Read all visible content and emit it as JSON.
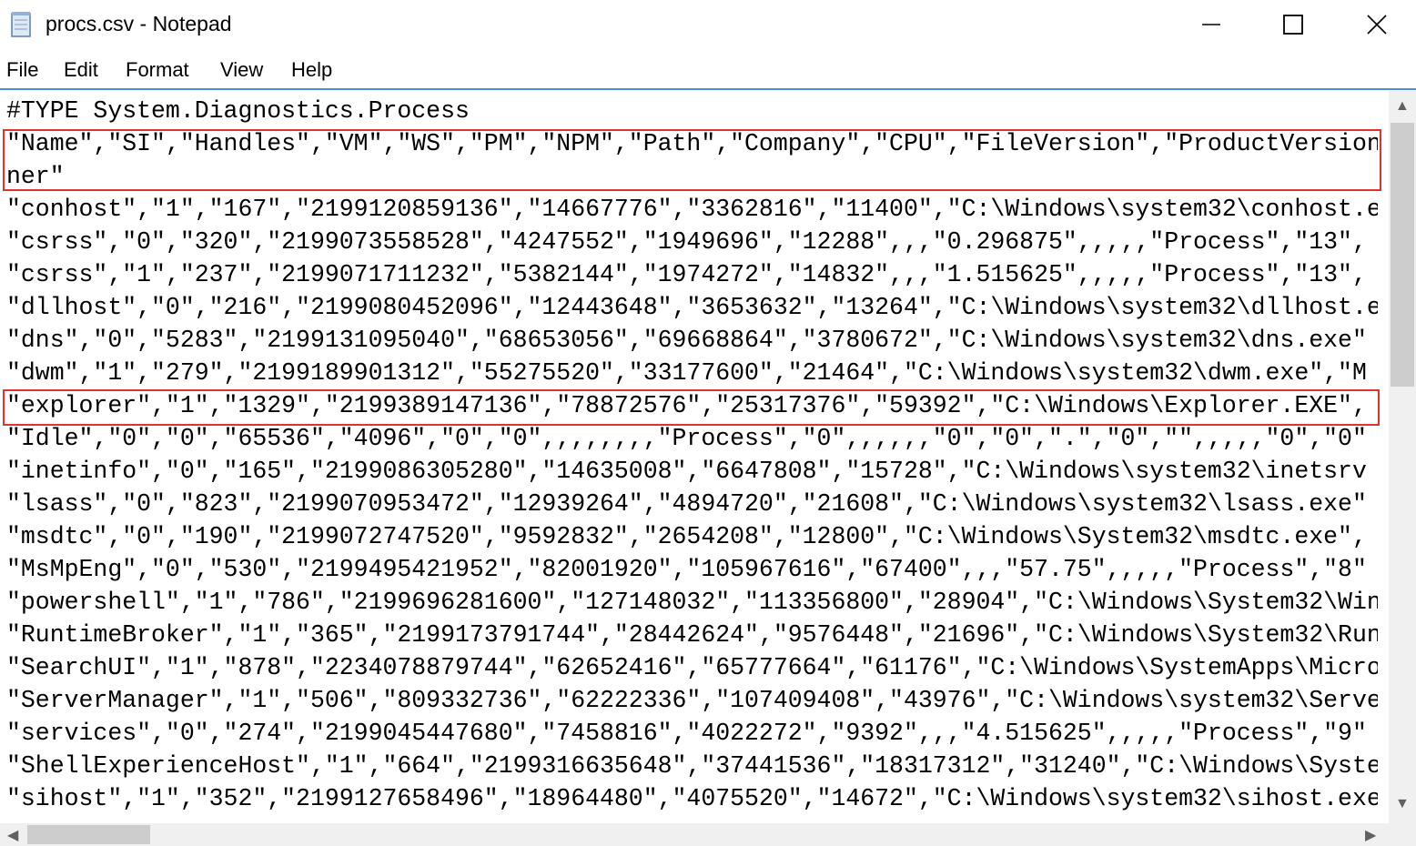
{
  "window": {
    "title": "procs.csv - Notepad",
    "icon": "notepad-icon",
    "controls": [
      "minimize-icon",
      "maximize-icon",
      "close-icon"
    ]
  },
  "menu": [
    "File",
    "Edit",
    "Format",
    "View",
    "Help"
  ],
  "editor": {
    "lines": [
      "#TYPE System.Diagnostics.Process",
      "\"Name\",\"SI\",\"Handles\",\"VM\",\"WS\",\"PM\",\"NPM\",\"Path\",\"Company\",\"CPU\",\"FileVersion\",\"ProductVersion",
      "ner\"",
      "\"conhost\",\"1\",\"167\",\"2199120859136\",\"14667776\",\"3362816\",\"11400\",\"C:\\Windows\\system32\\conhost.e",
      "\"csrss\",\"0\",\"320\",\"2199073558528\",\"4247552\",\"1949696\",\"12288\",,,\"0.296875\",,,,,\"Process\",\"13\",",
      "\"csrss\",\"1\",\"237\",\"2199071711232\",\"5382144\",\"1974272\",\"14832\",,,\"1.515625\",,,,,\"Process\",\"13\",",
      "\"dllhost\",\"0\",\"216\",\"2199080452096\",\"12443648\",\"3653632\",\"13264\",\"C:\\Windows\\system32\\dllhost.e",
      "\"dns\",\"0\",\"5283\",\"2199131095040\",\"68653056\",\"69668864\",\"3780672\",\"C:\\Windows\\system32\\dns.exe\"",
      "\"dwm\",\"1\",\"279\",\"2199189901312\",\"55275520\",\"33177600\",\"21464\",\"C:\\Windows\\system32\\dwm.exe\",\"M",
      "\"explorer\",\"1\",\"1329\",\"2199389147136\",\"78872576\",\"25317376\",\"59392\",\"C:\\Windows\\Explorer.EXE\",",
      "\"Idle\",\"0\",\"0\",\"65536\",\"4096\",\"0\",\"0\",,,,,,,,\"Process\",\"0\",,,,,,\"0\",\"0\",\".\",\"0\",\"\",,,,,\"0\",\"0\"",
      "\"inetinfo\",\"0\",\"165\",\"2199086305280\",\"14635008\",\"6647808\",\"15728\",\"C:\\Windows\\system32\\inetsrv",
      "\"lsass\",\"0\",\"823\",\"2199070953472\",\"12939264\",\"4894720\",\"21608\",\"C:\\Windows\\system32\\lsass.exe\"",
      "\"msdtc\",\"0\",\"190\",\"2199072747520\",\"9592832\",\"2654208\",\"12800\",\"C:\\Windows\\System32\\msdtc.exe\",",
      "\"MsMpEng\",\"0\",\"530\",\"2199495421952\",\"82001920\",\"105967616\",\"67400\",,,\"57.75\",,,,,\"Process\",\"8\"",
      "\"powershell\",\"1\",\"786\",\"2199696281600\",\"127148032\",\"113356800\",\"28904\",\"C:\\Windows\\System32\\Win",
      "\"RuntimeBroker\",\"1\",\"365\",\"2199173791744\",\"28442624\",\"9576448\",\"21696\",\"C:\\Windows\\System32\\Run",
      "\"SearchUI\",\"1\",\"878\",\"2234078879744\",\"62652416\",\"65777664\",\"61176\",\"C:\\Windows\\SystemApps\\Micro",
      "\"ServerManager\",\"1\",\"506\",\"809332736\",\"62222336\",\"107409408\",\"43976\",\"C:\\Windows\\system32\\Serve",
      "\"services\",\"0\",\"274\",\"2199045447680\",\"7458816\",\"4022272\",\"9392\",,,\"4.515625\",,,,,\"Process\",\"9\"",
      "\"ShellExperienceHost\",\"1\",\"664\",\"2199316635648\",\"37441536\",\"18317312\",\"31240\",\"C:\\Windows\\Syste",
      "\"sihost\",\"1\",\"352\",\"2199127658496\",\"18964480\",\"4075520\",\"14672\",\"C:\\Windows\\system32\\sihost.exe"
    ]
  },
  "highlight_color": "#e0332f"
}
